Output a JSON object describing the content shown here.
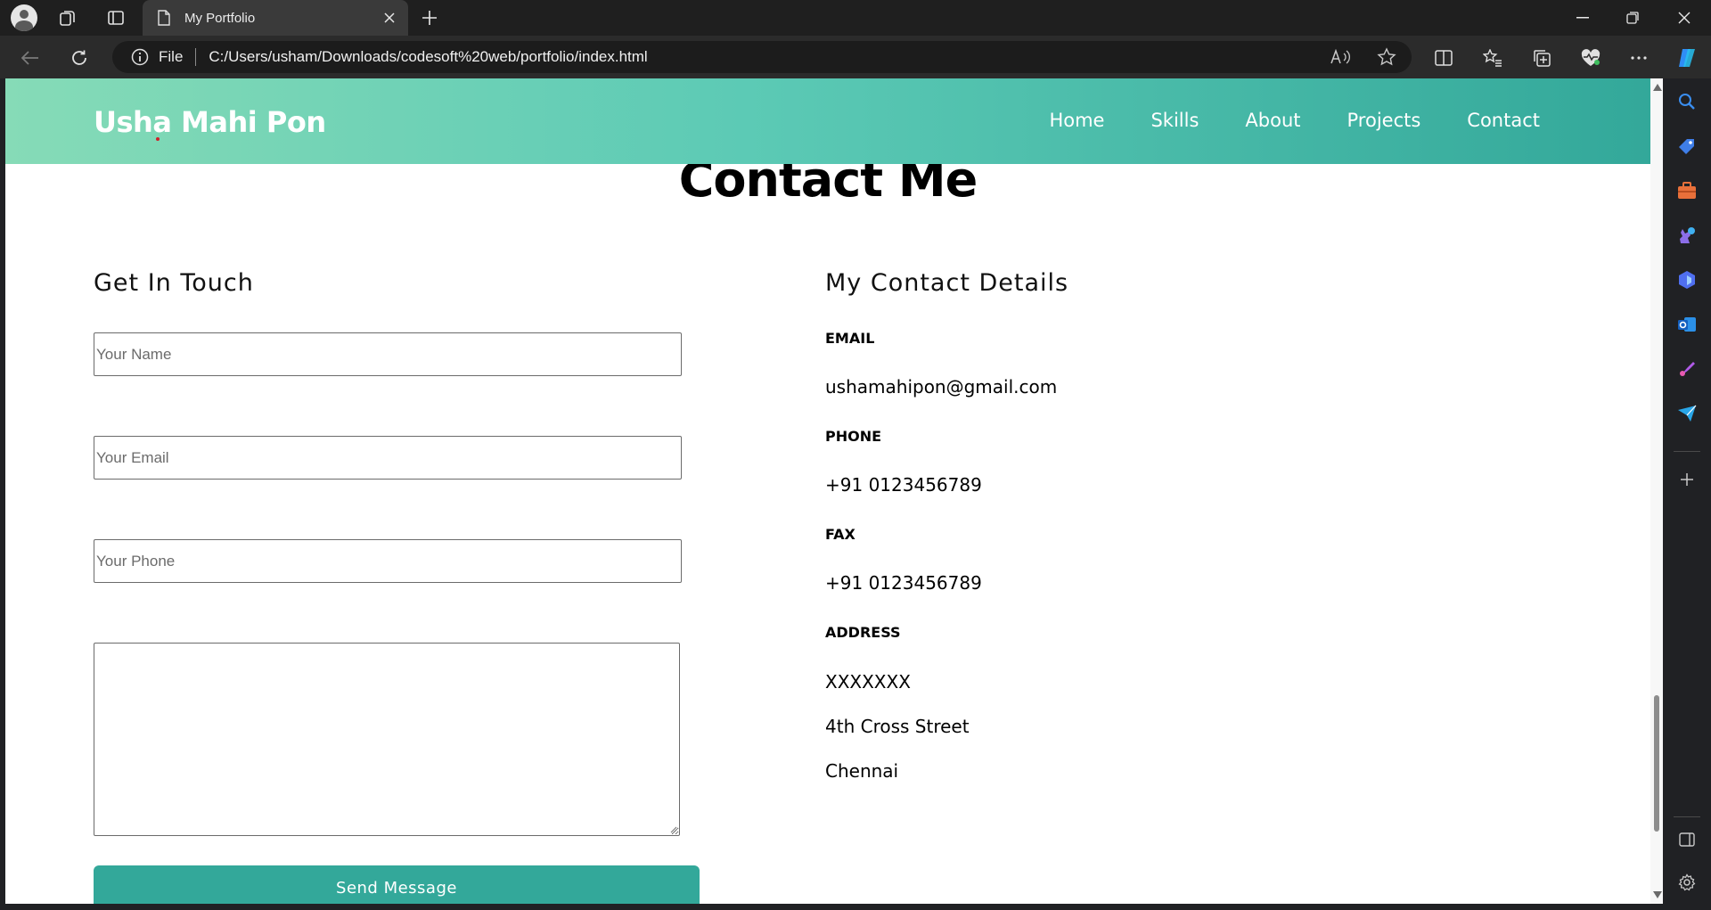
{
  "browser": {
    "tab_title": "My Portfolio",
    "address_scheme": "File",
    "url": "C:/Users/usham/Downloads/codesoft%20web/portfolio/index.html"
  },
  "site": {
    "brand": "Usha Mahi Pon",
    "nav": [
      "Home",
      "Skills",
      "About",
      "Projects",
      "Contact"
    ],
    "accent_color": "#33a89a"
  },
  "contact": {
    "title": "Contact Me",
    "form": {
      "heading": "Get In Touch",
      "name_placeholder": "Your Name",
      "email_placeholder": "Your Email",
      "phone_placeholder": "Your Phone",
      "message_value": "",
      "submit_label": "Send Message"
    },
    "details": {
      "heading": "My Contact Details",
      "email_label": "EMAIL",
      "email": "ushamahipon@gmail.com",
      "phone_label": "PHONE",
      "phone": "+91 0123456789",
      "fax_label": "FAX",
      "fax": "+91 0123456789",
      "address_label": "ADDRESS",
      "address_lines": [
        "XXXXXXX",
        "4th Cross Street",
        "Chennai"
      ]
    }
  }
}
